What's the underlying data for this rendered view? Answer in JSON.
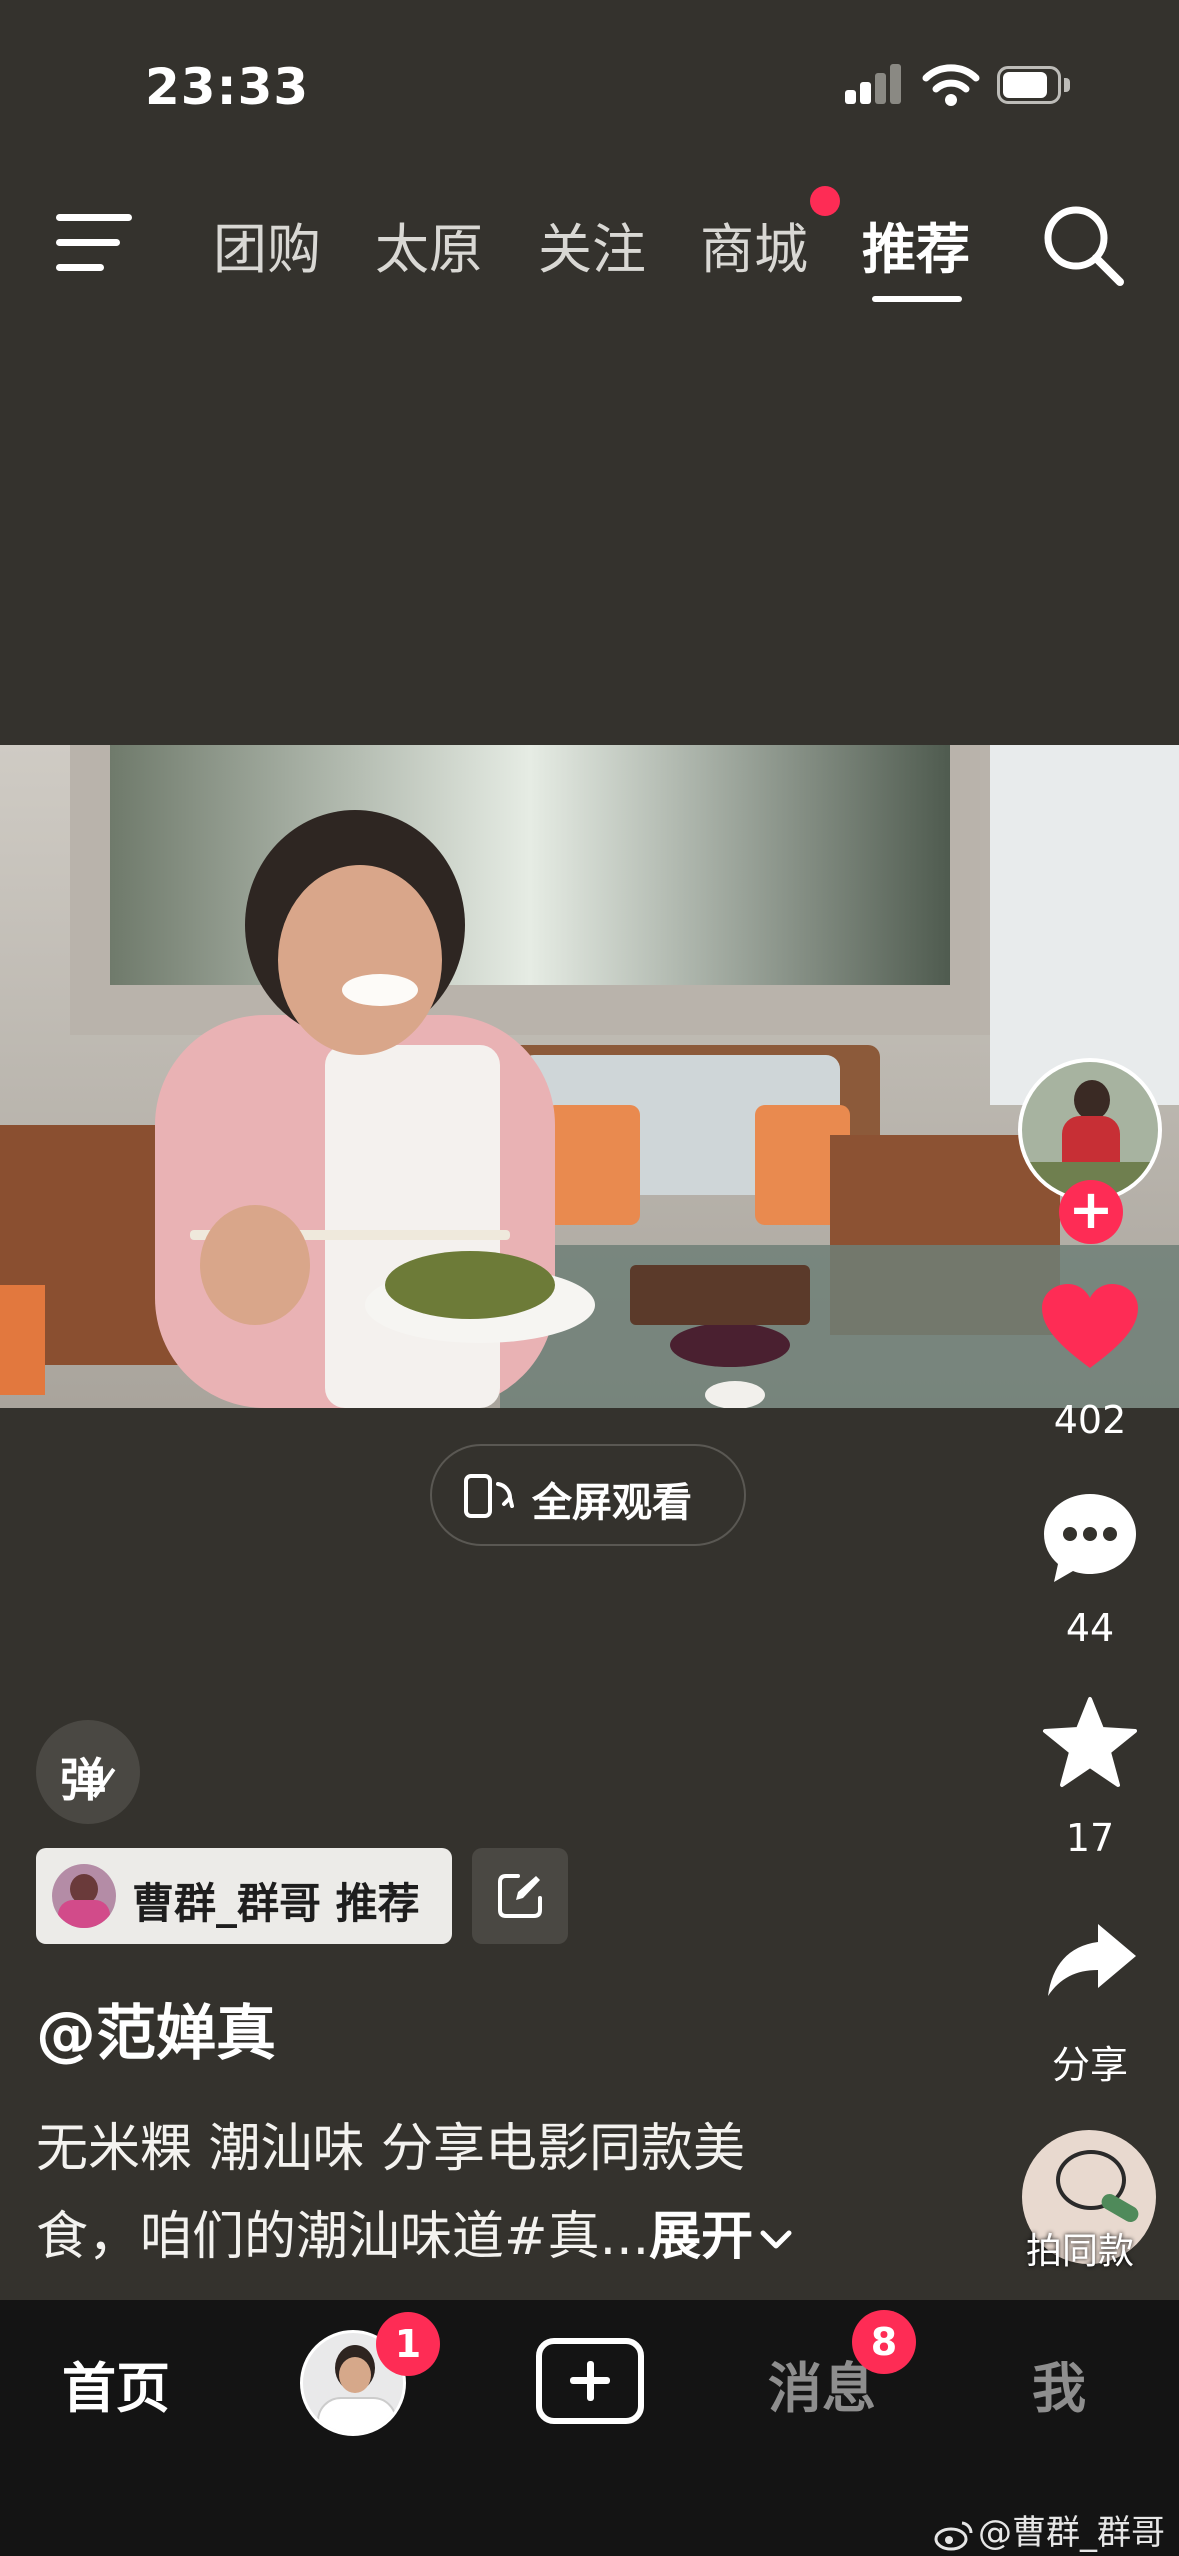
{
  "status_bar": {
    "time": "23:33"
  },
  "top_nav": {
    "tabs": [
      {
        "label": "团购"
      },
      {
        "label": "太原"
      },
      {
        "label": "关注"
      },
      {
        "label": "商城"
      },
      {
        "label": "推荐",
        "active": true
      }
    ]
  },
  "video": {
    "fullscreen_label": "全屏观看"
  },
  "actions": {
    "likes": "402",
    "comments": "44",
    "favorites": "17",
    "share_label": "分享",
    "same_style_label": "拍同款"
  },
  "post": {
    "danmu_label": "弹",
    "recommender": "曹群_群哥 推荐",
    "author": "@范婵真",
    "description_line1": "无米粿 潮汕味 分享电影同款美",
    "description_line2": "食，咱们的潮汕味道#真...",
    "expand_label": "展开"
  },
  "tab_bar": {
    "home": "首页",
    "friends_badge": "1",
    "messages": "消息",
    "messages_badge": "8",
    "me": "我"
  },
  "watermark": "@曹群_群哥",
  "colors": {
    "accent": "#fe2c55",
    "background": "#34322d",
    "tabbar": "#141414"
  }
}
